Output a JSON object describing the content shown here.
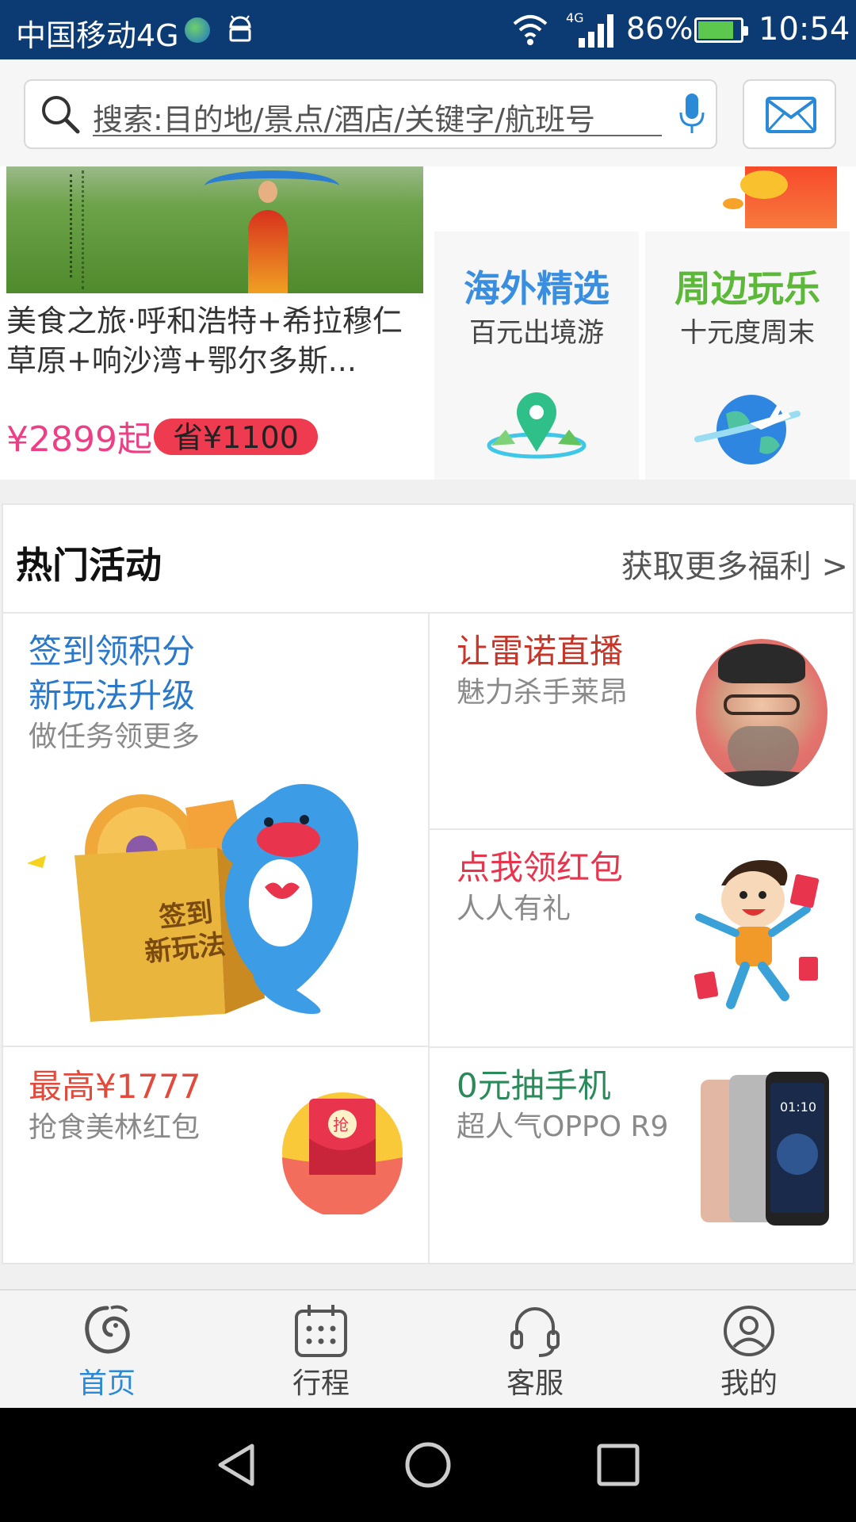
{
  "status_bar": {
    "carrier": "中国移动4G",
    "network": "4G",
    "battery_percent": "86%",
    "battery_level": 0.86,
    "time": "10:54"
  },
  "search": {
    "placeholder": "搜索:目的地/景点/酒店/关键字/航班号",
    "icon": "search-icon",
    "mic_icon": "microphone-icon",
    "message_icon": "mail-icon"
  },
  "promo": {
    "tour": {
      "title": "美食之旅·呼和浩特+希拉穆仁草原+响沙湾+鄂尔多斯...",
      "price": "¥2899起",
      "save": "省¥1100"
    },
    "cards": [
      {
        "title": "海外精选",
        "subtitle": "百元出境游",
        "color": "#3a8ee0",
        "icon": "location-pin-icon"
      },
      {
        "title": "周边玩乐",
        "subtitle": "十元度周末",
        "color": "#5cb838",
        "icon": "globe-plane-icon"
      }
    ]
  },
  "hot_activities": {
    "title": "热门活动",
    "more": "获取更多福利 >",
    "checkin": {
      "title_line1": "签到领积分",
      "title_line2": "新玩法升级",
      "subtitle": "做任务领更多",
      "art_text1": "签到",
      "art_text2": "新玩法"
    },
    "live": {
      "title": "让雷诺直播",
      "subtitle": "魅力杀手莱昂"
    },
    "red_packet": {
      "title": "点我领红包",
      "subtitle": "人人有礼"
    },
    "michelin": {
      "title": "最高¥1777",
      "subtitle": "抢食美林红包",
      "badge": "抢"
    },
    "phone": {
      "title": "0元抽手机",
      "subtitle": "超人气OPPO R9",
      "screen_time": "01:10"
    }
  },
  "bottom_nav": [
    {
      "label": "首页",
      "icon": "dolphin-home-icon",
      "active": true
    },
    {
      "label": "行程",
      "icon": "calendar-icon",
      "active": false
    },
    {
      "label": "客服",
      "icon": "headset-icon",
      "active": false
    },
    {
      "label": "我的",
      "icon": "user-icon",
      "active": false
    }
  ],
  "colors": {
    "status_bar_bg": "#0c3a73",
    "accent_blue": "#2b8ad8",
    "price_pink": "#ec3f86",
    "save_red": "#ee3b4f"
  }
}
